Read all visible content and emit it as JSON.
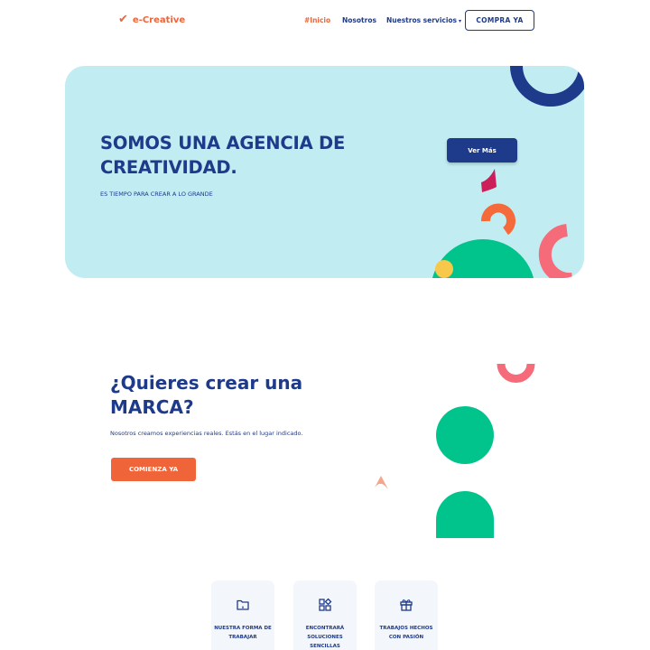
{
  "nav": {
    "brand": "e-Creative",
    "brand_icon": "check-icon",
    "links": [
      "#Inicio",
      "Nosotros",
      "Nuestros servicios"
    ],
    "dropdown_icon": "caret-down-icon",
    "cta": "COMPRA YA"
  },
  "hero": {
    "title": "SOMOS UNA AGENCIA DE CREATIVIDAD.",
    "subtitle": "ES TIEMPO PARA CREAR A LO GRANDE",
    "button": "Ver Más"
  },
  "brand_section": {
    "title": "¿Quieres crear una MARCA?",
    "text": "Nosotros creamos experiencias reales. Estás en el lugar indicado.",
    "button": "COMIENZA YA"
  },
  "features": [
    {
      "label": "NUESTRA FORMA DE TRABAJAR",
      "icon": "folder-icon"
    },
    {
      "label": "ENCONTRARÁ SOLUCIONES SENCILLAS",
      "icon": "grid-shapes-icon"
    },
    {
      "label": "TRABAJOS HECHOS CON PASIÓN",
      "icon": "gift-icon"
    }
  ],
  "colors": {
    "primary": "#1e3a8a",
    "accent": "#f0643a",
    "hero_bg": "#c1ecf2",
    "green": "#00c48c",
    "magenta": "#cc1f5a",
    "pink": "#f56b7a",
    "yellow": "#f7c84a"
  }
}
